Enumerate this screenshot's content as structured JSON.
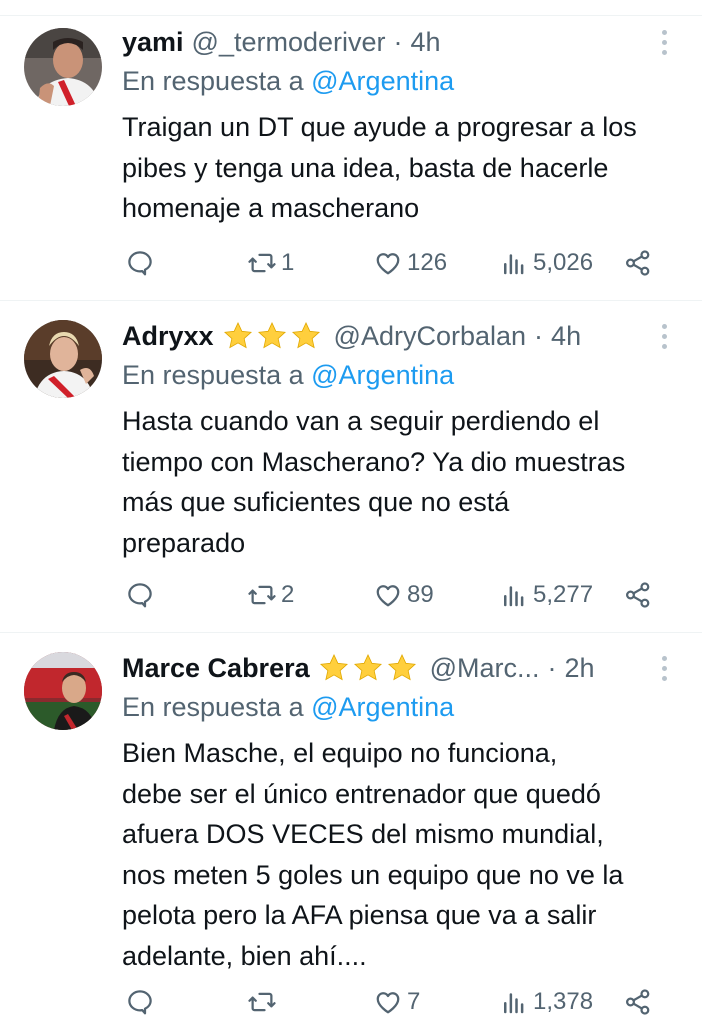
{
  "colors": {
    "accent": "#1d9bf0",
    "text": "#0f1419",
    "muted": "#536471",
    "star": "#ffcf3d"
  },
  "labels": {
    "replying_prefix": "En respuesta a"
  },
  "tweets": [
    {
      "name": "yami",
      "handle": "@_termoderiver",
      "time": "4h",
      "stars": 0,
      "reply_to": "@Argentina",
      "text_lines": [
        "Traigan un DT que ayude a progresar a los",
        "pibes y tenga una idea, basta de hacerle",
        "homenaje a mascherano"
      ],
      "stats": {
        "replies": "",
        "retweets": "1",
        "likes": "126",
        "views": "5,026"
      }
    },
    {
      "name": "Adryxx",
      "handle": "@AdryCorbalan",
      "time": "4h",
      "stars": 3,
      "reply_to": "@Argentina",
      "text_lines": [
        "Hasta cuando van a seguir perdiendo el",
        "tiempo con Mascherano? Ya dio muestras",
        "más que suficientes que no está",
        "preparado"
      ],
      "stats": {
        "replies": "",
        "retweets": "2",
        "likes": "89",
        "views": "5,277"
      }
    },
    {
      "name": "Marce Cabrera",
      "handle": "@Marc...",
      "time": "2h",
      "stars": 3,
      "reply_to": "@Argentina",
      "text_lines": [
        "Bien Masche, el equipo no funciona,",
        "debe ser el único entrenador que quedó",
        "afuera DOS VECES del mismo mundial,",
        "nos meten 5 goles un equipo que no ve la",
        "pelota pero la AFA piensa que va a salir",
        "adelante, bien ahí...."
      ],
      "stats": {
        "replies": "",
        "retweets": "",
        "likes": "7",
        "views": "1,378"
      }
    }
  ]
}
